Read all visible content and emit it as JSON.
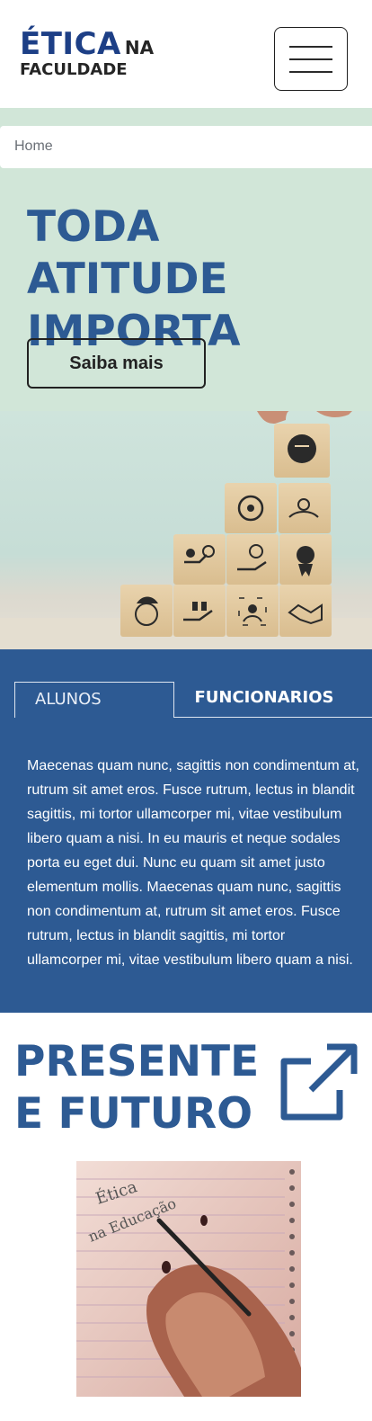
{
  "header": {
    "logo_main": "ÉTICA",
    "logo_suffix": "NA",
    "logo_sub": "FACULDADE",
    "menu_icon": "hamburger-menu-icon"
  },
  "breadcrumb": {
    "home": "Home"
  },
  "hero": {
    "title": "TODA ATITUDE IMPORTA",
    "button_label": "Saiba mais"
  },
  "tabs": {
    "items": [
      {
        "label": "ALUNOS",
        "active": true
      },
      {
        "label": "FUNCIONARIOS",
        "active": false
      }
    ],
    "content": "Maecenas quam nunc, sagittis non condimentum at, rutrum sit amet eros. Fusce rutrum, lectus in blandit sagittis, mi tortor ullamcorper mi, vitae vestibulum libero quam a nisi. In eu mauris et neque sodales porta eu eget dui. Nunc eu quam sit amet justo elementum mollis. Maecenas quam nunc, sagittis non condimentum at, rutrum sit amet eros. Fusce rutrum, lectus in blandit sagittis, mi tortor ullamcorper mi, vitae vestibulum libero quam a nisi."
  },
  "presente_futuro": {
    "title": "PRESENTE E FUTURO",
    "icon": "external-link-icon",
    "photo_text_line1": "Ética",
    "photo_text_line2": "na Educação"
  },
  "colors": {
    "brand_blue": "#2d5a93",
    "logo_blue": "#1d3f86",
    "hero_bg": "#d1e6d8"
  }
}
